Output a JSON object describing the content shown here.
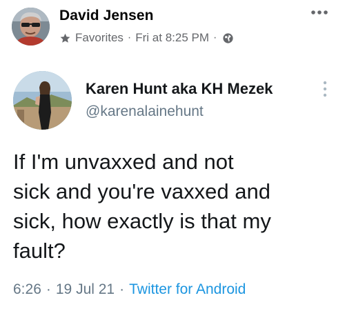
{
  "post": {
    "author_name": "David Jensen",
    "audience_label": "Favorites",
    "timestamp": "Fri at 8:25 PM",
    "separator": "·",
    "icons": {
      "audience": "star-icon",
      "privacy": "globe-icon",
      "menu": "more-horizontal-icon"
    }
  },
  "tweet": {
    "author_name": "Karen Hunt aka KH Mezek",
    "handle": "@karenalainehunt",
    "text": "If I'm unvaxxed and not\nsick and you're vaxxed and\nsick, how exactly is that my\nfault?",
    "time": "6:26",
    "date": "19 Jul 21",
    "source": "Twitter for Android",
    "separator": "·",
    "icons": {
      "menu": "more-vertical-icon"
    }
  },
  "colors": {
    "primary_text": "#050505",
    "secondary_text": "#65676b",
    "tweet_secondary": "#657786",
    "link_blue": "#1b95e0"
  }
}
